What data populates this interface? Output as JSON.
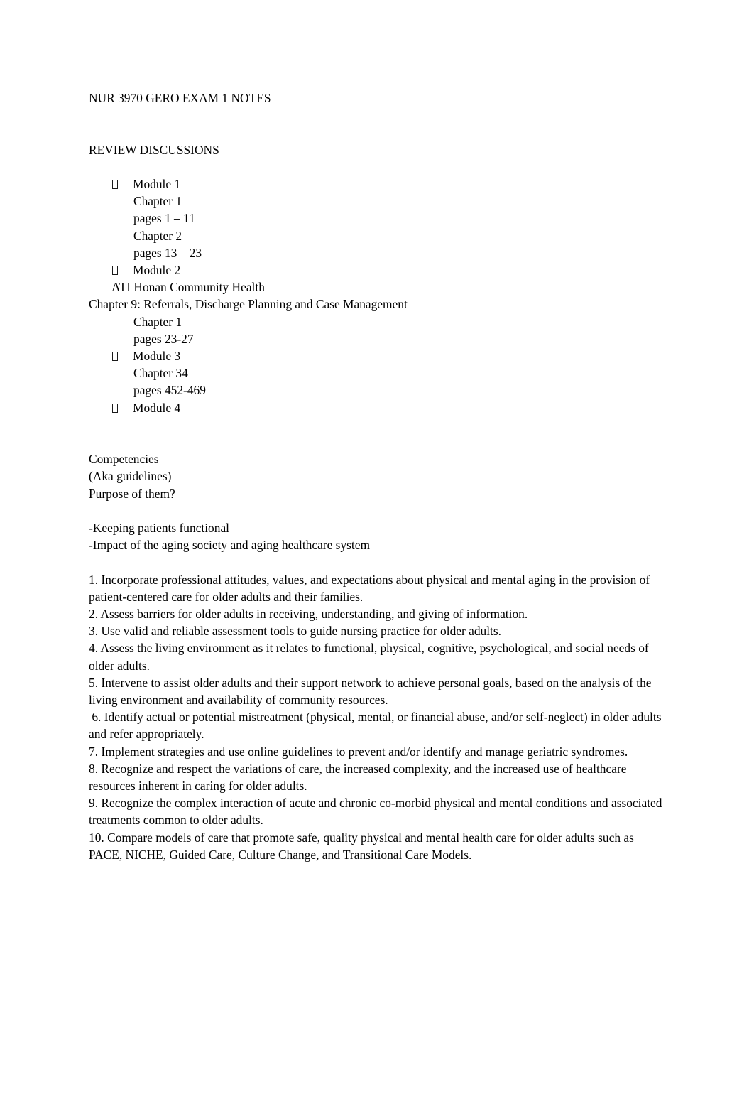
{
  "document": {
    "title": "NUR 3970 GERO EXAM 1 NOTES",
    "section_heading": "REVIEW DISCUSSIONS",
    "bullet_marker": "missing-glyph-box",
    "review_discussions": {
      "modules": [
        {
          "label": "Module 1",
          "sub_items": [
            "Chapter 1",
            "pages 1 – 11",
            "Chapter 2",
            "pages 13 – 23"
          ]
        },
        {
          "label": "Module 2",
          "mid_indent_lines": [
            "ATI Honan Community Health"
          ],
          "flush_lines": [
            "Chapter 9: Referrals, Discharge Planning and Case Management"
          ],
          "sub_items": [
            "Chapter 1",
            "pages 23-27"
          ]
        },
        {
          "label": "Module 3",
          "sub_items": [
            "Chapter 34",
            "pages 452-469"
          ]
        },
        {
          "label": "Module 4",
          "sub_items": []
        }
      ]
    },
    "competencies_block": {
      "heading": "Competencies",
      "aka": "(Aka guidelines)",
      "purpose_question": "Purpose of them?",
      "purpose_points": [
        "-Keeping patients functional",
        "-Impact of the aging society and aging healthcare system"
      ]
    },
    "competencies_list": [
      {
        "number": "1.",
        "text": "Incorporate professional attitudes, values, and expectations about physical and mental aging in the provision of patient-centered care for older adults and their families."
      },
      {
        "number": "2.",
        "text": "Assess barriers for older adults in receiving, understanding, and giving of information."
      },
      {
        "number": "3.",
        "text": "Use valid and reliable assessment tools to guide nursing practice for older adults."
      },
      {
        "number": "4.",
        "text": "Assess the living environment as it relates to functional, physical, cognitive, psychological, and social needs of older adults."
      },
      {
        "number": "5.",
        "text": "Intervene to assist older adults and their support network to achieve personal goals, based on the analysis of the living environment and availability of community resources."
      },
      {
        "number": " 6.",
        "text": "Identify actual or potential mistreatment (physical, mental, or financial abuse, and/or self-neglect) in older adults and refer appropriately."
      },
      {
        "number": "7.",
        "text": "Implement strategies and use online guidelines to prevent and/or identify and manage geriatric syndromes."
      },
      {
        "number": "8.",
        "text": "Recognize and respect the variations of care, the increased complexity, and the increased use of healthcare resources inherent in caring for older adults."
      },
      {
        "number": "9.",
        "text": "Recognize the complex interaction of acute and chronic co-morbid physical and mental conditions and associated treatments common to older adults."
      },
      {
        "number": "10.",
        "text": "Compare models of care that promote safe, quality physical and mental health care for older adults such as PACE, NICHE, Guided Care, Culture Change, and Transitional Care Models."
      }
    ]
  }
}
